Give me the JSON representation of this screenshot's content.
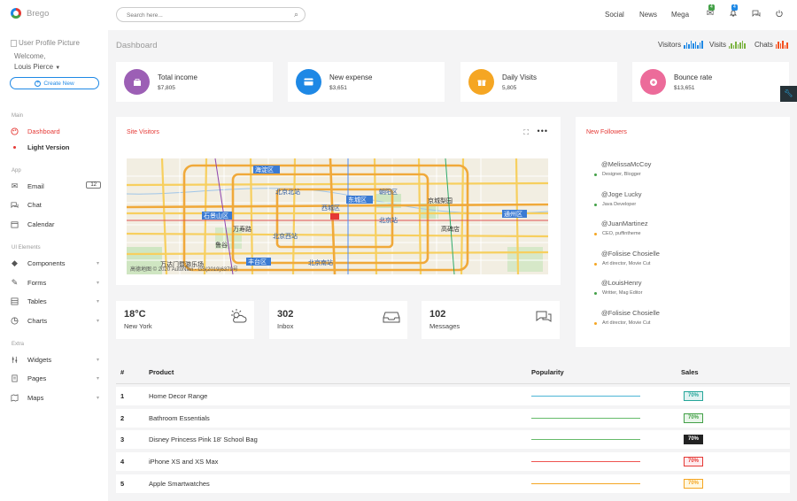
{
  "brand": {
    "name": "Brego"
  },
  "profile": {
    "picture_alt": "User Profile Picture",
    "welcome": "Welcome,",
    "name": "Louis Pierce",
    "create_label": "Create New"
  },
  "sidebar": {
    "sections": [
      {
        "label": "Main"
      },
      {
        "label": "App"
      },
      {
        "label": "UI Elements"
      },
      {
        "label": "Extra"
      }
    ],
    "items": [
      {
        "label": "Dashboard",
        "icon": "palette-icon"
      },
      {
        "label": "Light Version",
        "icon": "dot-icon"
      },
      {
        "label": "Email",
        "icon": "mail-icon",
        "badge": "12"
      },
      {
        "label": "Chat",
        "icon": "chat-icon"
      },
      {
        "label": "Calendar",
        "icon": "calendar-icon"
      },
      {
        "label": "Components",
        "icon": "diamond-icon"
      },
      {
        "label": "Forms",
        "icon": "pencil-icon"
      },
      {
        "label": "Tables",
        "icon": "table-icon"
      },
      {
        "label": "Charts",
        "icon": "pie-chart-icon"
      },
      {
        "label": "Widgets",
        "icon": "sliders-icon"
      },
      {
        "label": "Pages",
        "icon": "pages-icon"
      },
      {
        "label": "Maps",
        "icon": "map-icon"
      }
    ]
  },
  "header": {
    "search_placeholder": "Search here...",
    "links": [
      "Social",
      "News",
      "Mega"
    ],
    "mail_badge": "4",
    "bell_badge": "4",
    "colors": {
      "green": "#43a047",
      "blue": "#1e88e5"
    }
  },
  "dashboard": {
    "title": "Dashboard",
    "quick_stats": [
      {
        "label": "Visitors",
        "color": "#1e88e5"
      },
      {
        "label": "Visits",
        "color": "#7cb342"
      },
      {
        "label": "Chats",
        "color": "#f4511e"
      }
    ]
  },
  "stats": [
    {
      "label": "Total income",
      "value": "$7,805",
      "color": "#9c5fb5",
      "icon": "wallet-icon"
    },
    {
      "label": "New expense",
      "value": "$3,651",
      "color": "#1e88e5",
      "icon": "card-icon"
    },
    {
      "label": "Daily Visits",
      "value": "5,805",
      "color": "#f5a623",
      "icon": "gift-icon"
    },
    {
      "label": "Bounce rate",
      "value": "$13,651",
      "color": "#ec6b9a",
      "icon": "plus-circle-icon"
    }
  ],
  "site_visitors": {
    "title": "Site Visitors",
    "map_attribution": "高德地图 © 2020 AutoNavi - GS(2019)6379号",
    "districts": [
      "海淀区",
      "朝阳区",
      "东城区",
      "西城区",
      "丰台区",
      "石景山区",
      "通州区",
      "北京北站",
      "北京西站",
      "北京南站",
      "北京站",
      "高碑店",
      "京城梨园",
      "万寿路",
      "鲁谷",
      "万达门暨游乐场"
    ]
  },
  "mini": [
    {
      "value": "18°C",
      "label": "New York",
      "icon": "weather-icon"
    },
    {
      "value": "302",
      "label": "Inbox",
      "icon": "inbox-icon"
    },
    {
      "value": "102",
      "label": "Messages",
      "icon": "chat-bubbles-icon"
    }
  ],
  "followers": {
    "title": "New Followers",
    "items": [
      {
        "name": "@MelissaMcCoy",
        "role": "Designer, Blogger",
        "color": "#43a047"
      },
      {
        "name": "@Joge Lucky",
        "role": "Java Developer",
        "color": "#43a047"
      },
      {
        "name": "@JuanMartinez",
        "role": "CEO, puffintheme",
        "color": "#f5a623"
      },
      {
        "name": "@Folisise Chosielle",
        "role": "Art director, Movie Cut",
        "color": "#f5a623"
      },
      {
        "name": "@LouisHenry",
        "role": "Writter, Mag Editor",
        "color": "#43a047"
      },
      {
        "name": "@Folisise Chosielle",
        "role": "Art director, Movie Cut",
        "color": "#f5a623"
      }
    ]
  },
  "table": {
    "headers": [
      "#",
      "Product",
      "Popularity",
      "Sales"
    ],
    "rows": [
      {
        "num": "1",
        "product": "Home Decor Range",
        "sales": "70%",
        "color": "#4db6d6"
      },
      {
        "num": "2",
        "product": "Bathroom Essentials",
        "sales": "70%",
        "color": "#66bb6a"
      },
      {
        "num": "3",
        "product": "Disney Princess Pink 18' School Bag",
        "sales": "70%",
        "color": "#66bb6a"
      },
      {
        "num": "4",
        "product": "iPhone XS and XS Max",
        "sales": "70%",
        "color": "#ef5350"
      },
      {
        "num": "5",
        "product": "Apple Smartwatches",
        "sales": "70%",
        "color": "#f5a623"
      }
    ]
  }
}
